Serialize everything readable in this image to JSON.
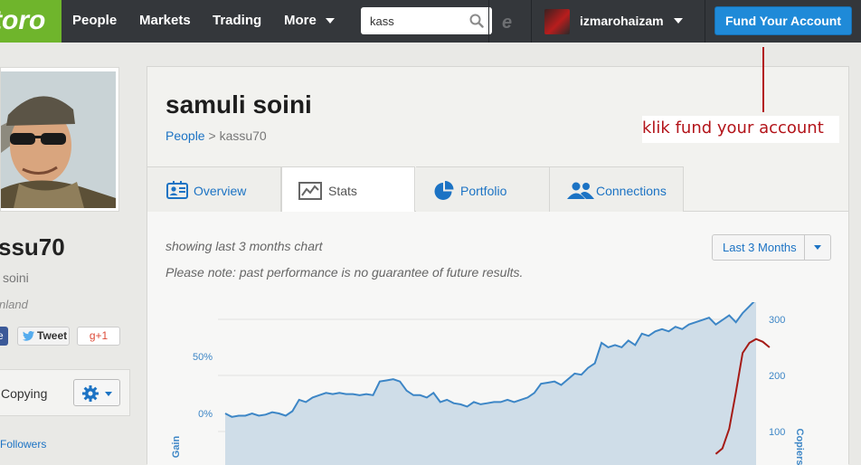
{
  "nav": {
    "logo": "toro",
    "items": [
      {
        "label": "People"
      },
      {
        "label": "Markets"
      },
      {
        "label": "Trading"
      },
      {
        "label": "More"
      }
    ],
    "search_value": "kass",
    "user_name": "izmarohaizam",
    "fund_button": "Fund Your Account"
  },
  "annotation": {
    "text": "klik fund your account",
    "color": "#b3141a"
  },
  "profile": {
    "username_partial": "ssu70",
    "fullname_partial": "soini",
    "country_partial": "nland",
    "share_facebook": "e",
    "share_tweet": "Tweet",
    "share_gplus": "g+1",
    "copying_label": "Copying",
    "followers_label": "Followers"
  },
  "header": {
    "name": "samuli soini",
    "breadcrumb_link": "People",
    "breadcrumb_sep": " > ",
    "breadcrumb_current": "kassu70"
  },
  "tabs": [
    {
      "label": "Overview",
      "icon": "overview-icon"
    },
    {
      "label": "Stats",
      "icon": "stats-icon"
    },
    {
      "label": "Portfolio",
      "icon": "pie-chart-icon"
    },
    {
      "label": "Connections",
      "icon": "connections-icon"
    }
  ],
  "stats": {
    "note_period": "showing last 3 months chart",
    "note_disclaimer": "Please note: past performance is no guarantee of future results.",
    "period_select": "Last 3 Months"
  },
  "chart_data": {
    "type": "area",
    "left_axis": {
      "label": "Gain",
      "ticks": [
        "50%",
        "0%"
      ],
      "tick_values": [
        50,
        0
      ]
    },
    "right_axis": {
      "label": "Copiers",
      "ticks": [
        "300",
        "200",
        "100"
      ],
      "tick_values": [
        300,
        200,
        100
      ]
    },
    "series": [
      {
        "axis": "left",
        "style": "area",
        "color": "#3d86c6",
        "fill": "#cfdde8",
        "values": [
          0,
          -3,
          -2,
          -2,
          0,
          -2,
          -1,
          1,
          0,
          -2,
          2,
          12,
          10,
          14,
          16,
          18,
          17,
          18,
          17,
          17,
          16,
          17,
          16,
          28,
          29,
          30,
          28,
          20,
          16,
          16,
          14,
          18,
          10,
          12,
          9,
          8,
          6,
          10,
          8,
          9,
          10,
          10,
          12,
          10,
          12,
          14,
          18,
          26,
          27,
          28,
          25,
          30,
          35,
          34,
          40,
          44,
          62,
          58,
          60,
          58,
          64,
          60,
          70,
          68,
          72,
          74,
          72,
          76,
          74,
          78,
          80,
          82,
          84,
          78,
          82,
          86,
          80,
          88,
          94,
          100
        ]
      },
      {
        "axis": "right",
        "style": "line",
        "color": "#a51b16",
        "values": [
          null,
          null,
          null,
          null,
          null,
          null,
          null,
          null,
          null,
          null,
          null,
          null,
          null,
          null,
          null,
          null,
          null,
          null,
          null,
          null,
          null,
          null,
          null,
          null,
          null,
          null,
          null,
          null,
          null,
          null,
          null,
          null,
          null,
          null,
          null,
          null,
          null,
          null,
          null,
          null,
          null,
          null,
          null,
          null,
          null,
          null,
          null,
          null,
          null,
          null,
          null,
          null,
          null,
          null,
          null,
          null,
          null,
          null,
          null,
          null,
          null,
          null,
          null,
          null,
          null,
          null,
          null,
          null,
          null,
          null,
          null,
          null,
          null,
          60,
          70,
          105,
          170,
          240,
          258,
          265,
          260,
          250
        ]
      }
    ],
    "grid": true
  },
  "colors": {
    "nav_bg": "#34373b",
    "logo_green": "#6fb52c",
    "accent_blue": "#1f8ad8",
    "link_blue": "#1c73c4"
  }
}
